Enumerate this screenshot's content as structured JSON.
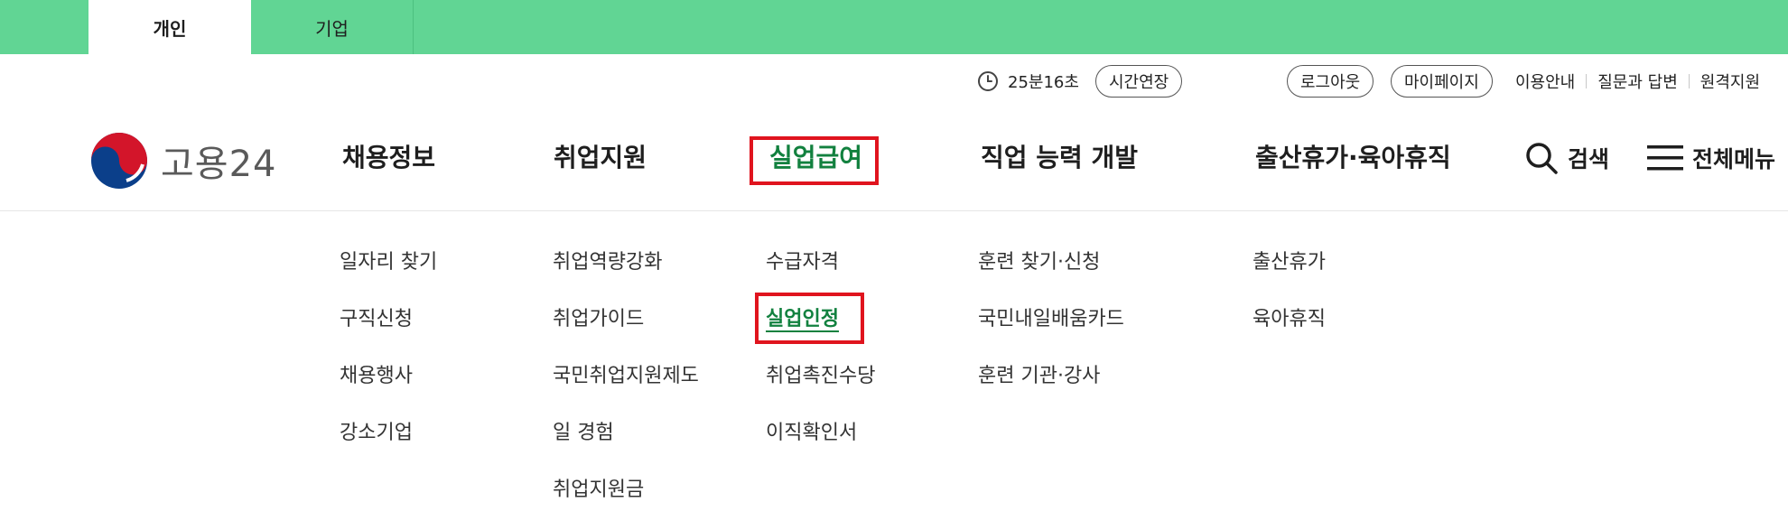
{
  "top_tabs": [
    {
      "label": "개인",
      "active": true
    },
    {
      "label": "기업",
      "active": false
    }
  ],
  "utility": {
    "timer": "25분16초",
    "extend_button": "시간연장",
    "logout_button": "로그아웃",
    "mypage_button": "마이페이지",
    "links": [
      "이용안내",
      "질문과 답변",
      "원격지원"
    ]
  },
  "logo": {
    "text": "고용24"
  },
  "nav": [
    {
      "label": "채용정보"
    },
    {
      "label": "취업지원"
    },
    {
      "label": "실업급여",
      "active": true
    },
    {
      "label": "직업 능력 개발"
    },
    {
      "label": "출산휴가·육아휴직"
    }
  ],
  "tools": {
    "search": "검색",
    "all_menu": "전체메뉴"
  },
  "submenu": {
    "col1": [
      "일자리 찾기",
      "구직신청",
      "채용행사",
      "강소기업"
    ],
    "col2": [
      "취업역량강화",
      "취업가이드",
      "국민취업지원제도",
      "일 경험",
      "취업지원금"
    ],
    "col3": [
      "수급자격",
      "실업인정",
      "취업촉진수당",
      "이직확인서"
    ],
    "col4": [
      "훈련 찾기·신청",
      "국민내일배움카드",
      "훈련 기관·강사"
    ],
    "col5": [
      "출산휴가",
      "육아휴직"
    ]
  },
  "colors": {
    "top_bar": "#61d594",
    "active_green": "#12813f",
    "highlight_red": "#e0141e"
  },
  "icons": [
    "clock-icon",
    "government-logo-icon",
    "search-icon",
    "hamburger-menu-icon"
  ]
}
